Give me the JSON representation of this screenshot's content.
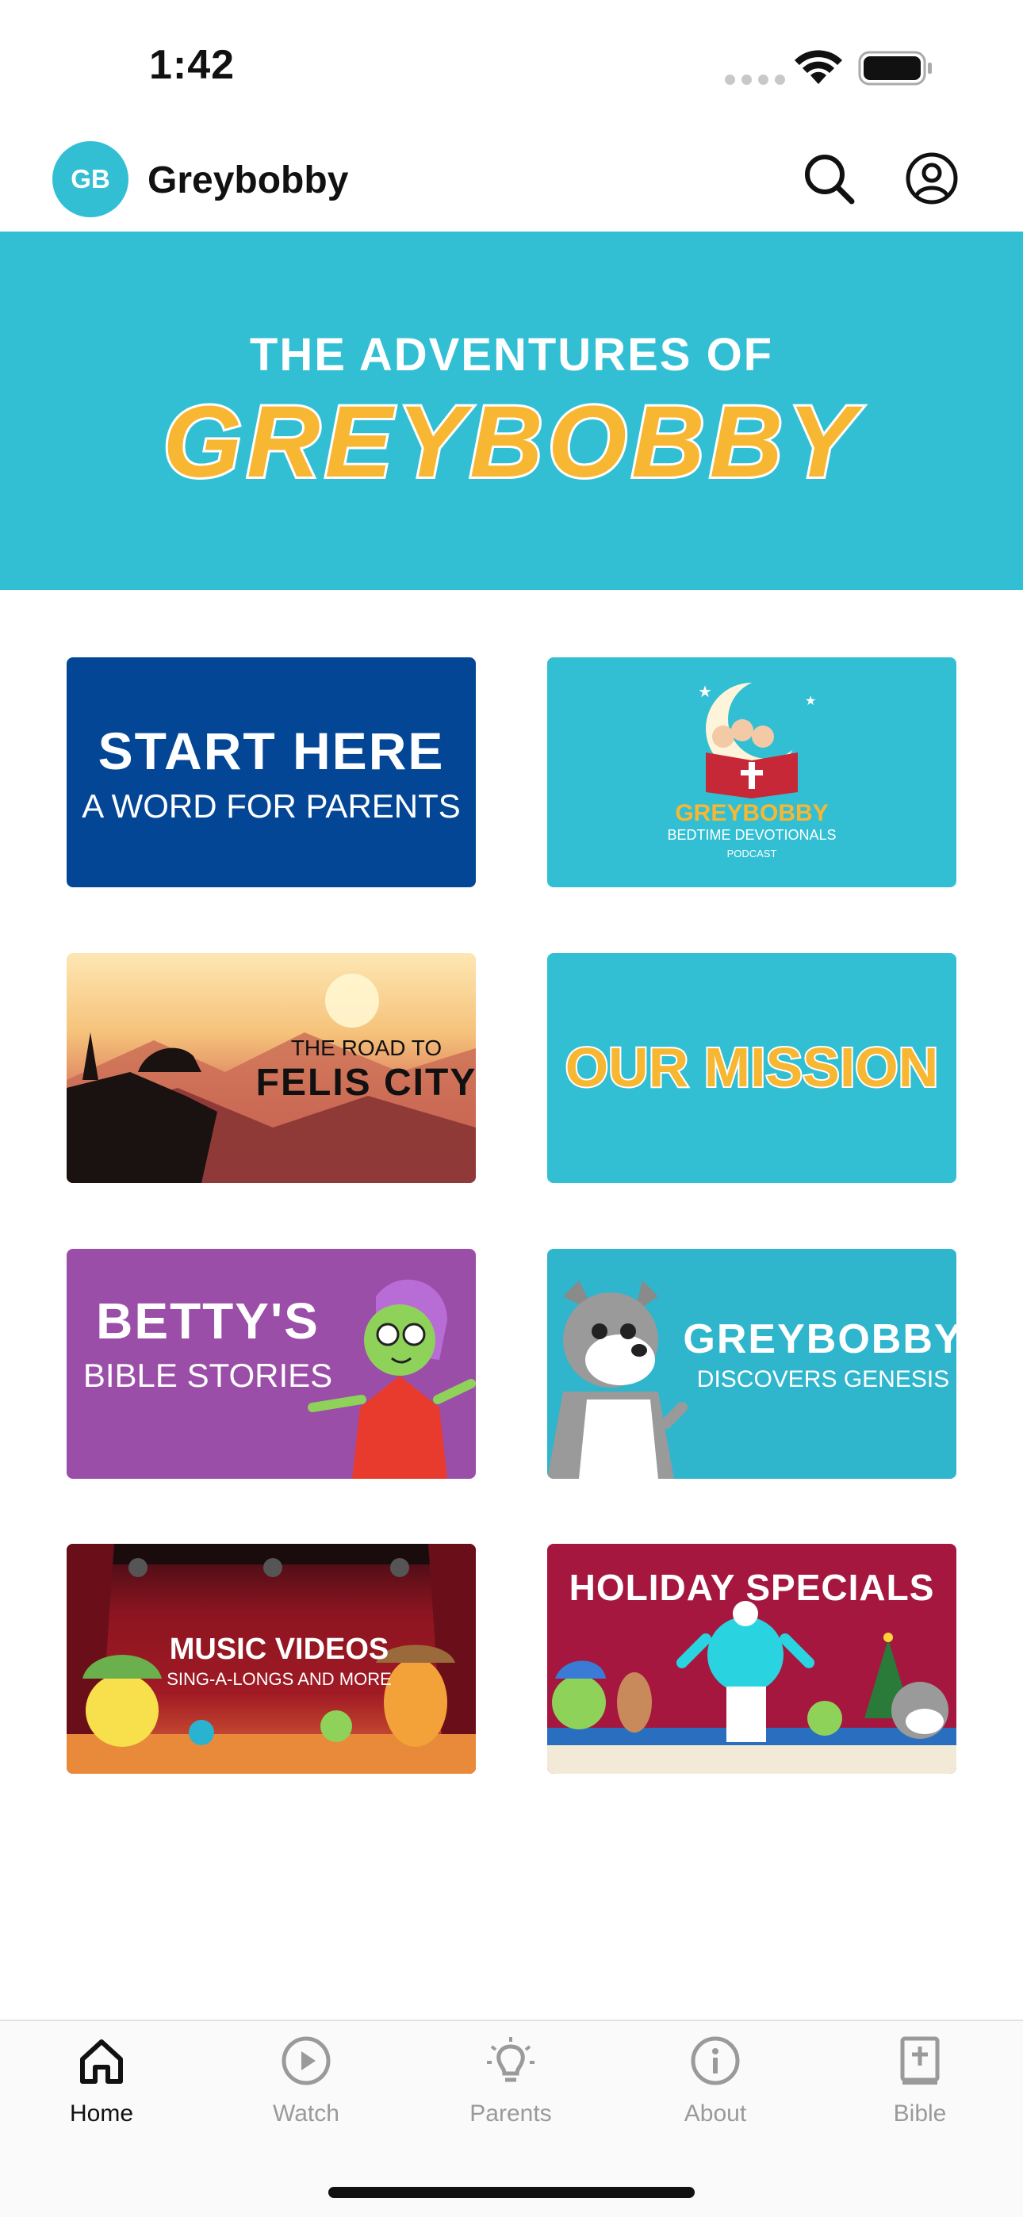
{
  "status_bar": {
    "time": "1:42"
  },
  "header": {
    "logo_text": "GB",
    "title": "Greybobby"
  },
  "banner": {
    "subtitle": "THE ADVENTURES OF",
    "title": "GREYBOBBY"
  },
  "tiles": [
    {
      "main": "START HERE",
      "sub": "A WORD FOR PARENTS"
    },
    {
      "main": "GREYBOBBY",
      "sub": "BEDTIME DEVOTIONALS",
      "small": "PODCAST"
    },
    {
      "sub": "THE ROAD TO",
      "main": "FELIS CITY"
    },
    {
      "main": "OUR MISSION"
    },
    {
      "main": "BETTY'S",
      "sub": "BIBLE STORIES"
    },
    {
      "main": "GREYBOBBY",
      "sub": "DISCOVERS GENESIS"
    },
    {
      "main": "MUSIC VIDEOS",
      "sub": "SING-A-LONGS AND MORE"
    },
    {
      "main": "HOLIDAY SPECIALS"
    }
  ],
  "tab_bar": {
    "tabs": [
      {
        "label": "Home",
        "icon": "home-icon",
        "active": true
      },
      {
        "label": "Watch",
        "icon": "play-circle-icon",
        "active": false
      },
      {
        "label": "Parents",
        "icon": "lightbulb-icon",
        "active": false
      },
      {
        "label": "About",
        "icon": "info-circle-icon",
        "active": false
      },
      {
        "label": "Bible",
        "icon": "bible-icon",
        "active": false
      }
    ]
  },
  "colors": {
    "brand_teal": "#33bfd3",
    "brand_orange": "#f8b733",
    "navy": "#044696",
    "purple": "#9b4ea7",
    "crimson": "#a5173f"
  }
}
